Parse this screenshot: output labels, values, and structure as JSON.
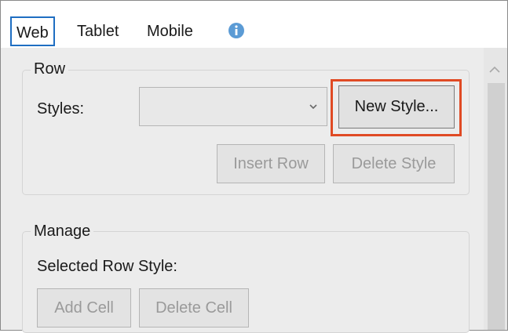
{
  "tabs": [
    {
      "label": "Web",
      "active": true
    },
    {
      "label": "Tablet",
      "active": false
    },
    {
      "label": "Mobile",
      "active": false
    }
  ],
  "info_icon": "info-icon",
  "row_group": {
    "legend": "Row",
    "styles_label": "Styles:",
    "styles_value": "",
    "new_style_label": "New Style...",
    "insert_row_label": "Insert Row",
    "delete_style_label": "Delete Style"
  },
  "manage_group": {
    "legend": "Manage",
    "selected_row_style_label": "Selected Row Style:",
    "add_cell_label": "Add Cell",
    "delete_cell_label": "Delete Cell"
  },
  "colors": {
    "highlight": "#e04a24",
    "active_tab_border": "#1f6ec2",
    "info_icon": "#5b9bd5"
  }
}
